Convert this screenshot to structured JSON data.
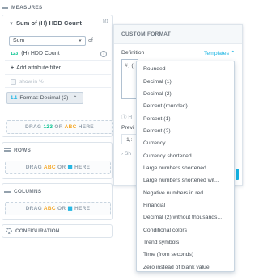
{
  "left_panel": {
    "measures": {
      "heading": "MEASURES",
      "measure_title": "Sum of (H) HDD Count",
      "badge": "M1",
      "aggregation": "Sum",
      "of_label": "of",
      "attribute_type": "123",
      "attribute": "(H) HDD Count",
      "add_filter": "Add attribute filter",
      "show_in_percent": "show in %",
      "format_prefix": "1.1",
      "format_button": "Format: Decimal (2)",
      "drop_prefix": "DRAG",
      "drop_num": "123",
      "drop_or": "OR",
      "drop_abc": "ABC",
      "drop_here": "HERE"
    },
    "rows": {
      "heading": "ROWS",
      "drop_prefix": "DRAG",
      "drop_abc": "ABC",
      "drop_or": "OR",
      "drop_here": "HERE"
    },
    "columns": {
      "heading": "COLUMNS",
      "drop_prefix": "DRAG",
      "drop_abc": "ABC",
      "drop_or": "OR",
      "drop_here": "HERE"
    },
    "configuration": {
      "heading": "CONFIGURATION"
    }
  },
  "custom_format": {
    "title": "CUSTOM FORMAT",
    "definition_label": "Definition",
    "templates_label": "Templates",
    "definition_value": "#,(",
    "help_text": "H",
    "preview_label": "Previ",
    "preview_value": "-1,:",
    "show_more": "Sh"
  },
  "templates_menu": {
    "items": [
      "Rounded",
      "Decimal (1)",
      "Decimal (2)",
      "Percent (rounded)",
      "Percent (1)",
      "Percent (2)",
      "Currency",
      "Currency shortened",
      "Large numbers shortened",
      "Large numbers shortened wit...",
      "Negative numbers in red",
      "Financial",
      "Decimal (2) without thousands...",
      "Conditional colors",
      "Trend symbols",
      "Time (from seconds)",
      "Zero instead of blank value"
    ]
  },
  "colors": {
    "accent": "#14b2e2",
    "number_tag": "#00c18d",
    "text_tag": "#f5a623"
  }
}
